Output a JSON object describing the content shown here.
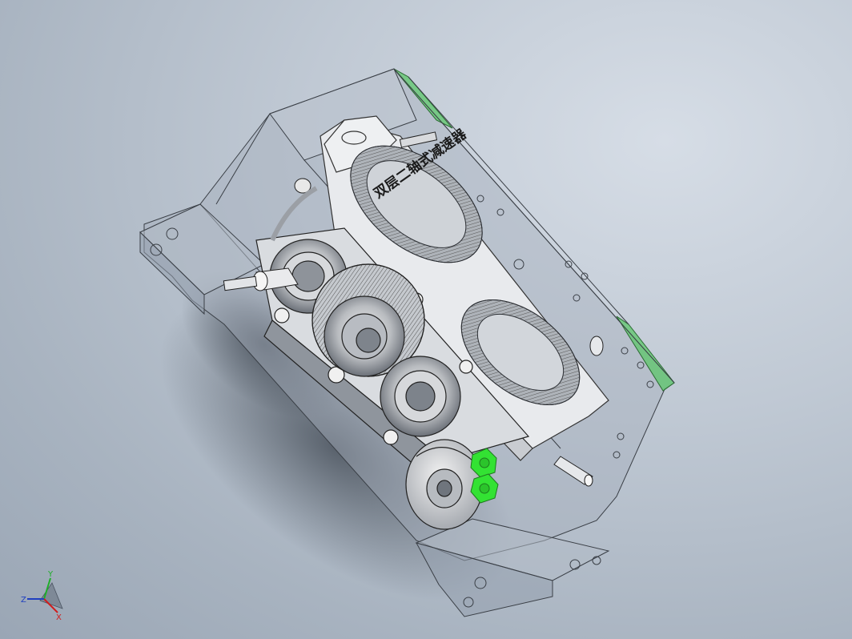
{
  "model": {
    "label": "双层二轴式减速器"
  },
  "triad": {
    "x_label": "X",
    "y_label": "Y",
    "z_label": "Z",
    "x_color": "#d01c1c",
    "y_color": "#1fae2a",
    "z_color": "#1f3fbf"
  },
  "colors": {
    "background_top": "#d6dde6",
    "background_bottom": "#9aa6b5",
    "housing_edge": "#3a3f46",
    "highlight_green": "#33e233",
    "face_green": "#5cc56a"
  }
}
